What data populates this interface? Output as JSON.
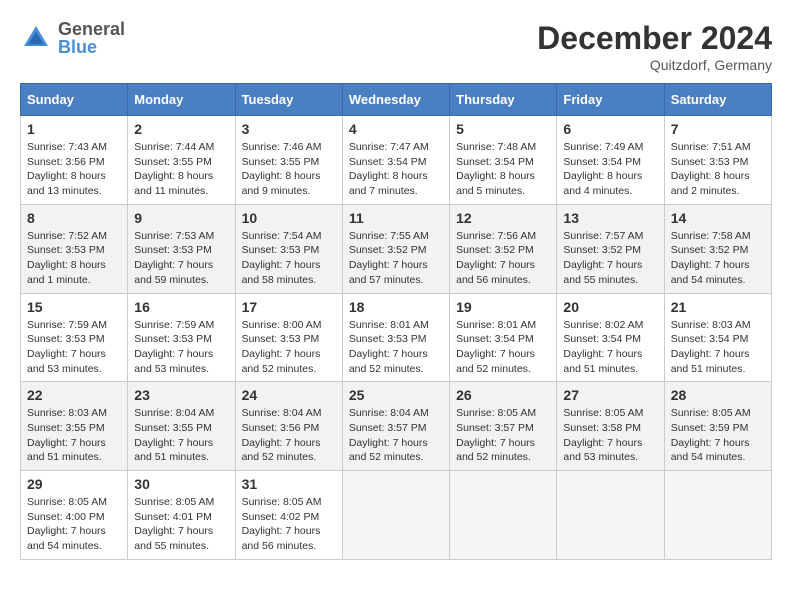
{
  "header": {
    "logo_line1": "General",
    "logo_line2": "Blue",
    "month_title": "December 2024",
    "location": "Quitzdorf, Germany"
  },
  "weekdays": [
    "Sunday",
    "Monday",
    "Tuesday",
    "Wednesday",
    "Thursday",
    "Friday",
    "Saturday"
  ],
  "weeks": [
    [
      {
        "day": 1,
        "sunrise": "7:43 AM",
        "sunset": "3:56 PM",
        "daylight": "8 hours and 13 minutes."
      },
      {
        "day": 2,
        "sunrise": "7:44 AM",
        "sunset": "3:55 PM",
        "daylight": "8 hours and 11 minutes."
      },
      {
        "day": 3,
        "sunrise": "7:46 AM",
        "sunset": "3:55 PM",
        "daylight": "8 hours and 9 minutes."
      },
      {
        "day": 4,
        "sunrise": "7:47 AM",
        "sunset": "3:54 PM",
        "daylight": "8 hours and 7 minutes."
      },
      {
        "day": 5,
        "sunrise": "7:48 AM",
        "sunset": "3:54 PM",
        "daylight": "8 hours and 5 minutes."
      },
      {
        "day": 6,
        "sunrise": "7:49 AM",
        "sunset": "3:54 PM",
        "daylight": "8 hours and 4 minutes."
      },
      {
        "day": 7,
        "sunrise": "7:51 AM",
        "sunset": "3:53 PM",
        "daylight": "8 hours and 2 minutes."
      }
    ],
    [
      {
        "day": 8,
        "sunrise": "7:52 AM",
        "sunset": "3:53 PM",
        "daylight": "8 hours and 1 minute."
      },
      {
        "day": 9,
        "sunrise": "7:53 AM",
        "sunset": "3:53 PM",
        "daylight": "7 hours and 59 minutes."
      },
      {
        "day": 10,
        "sunrise": "7:54 AM",
        "sunset": "3:53 PM",
        "daylight": "7 hours and 58 minutes."
      },
      {
        "day": 11,
        "sunrise": "7:55 AM",
        "sunset": "3:52 PM",
        "daylight": "7 hours and 57 minutes."
      },
      {
        "day": 12,
        "sunrise": "7:56 AM",
        "sunset": "3:52 PM",
        "daylight": "7 hours and 56 minutes."
      },
      {
        "day": 13,
        "sunrise": "7:57 AM",
        "sunset": "3:52 PM",
        "daylight": "7 hours and 55 minutes."
      },
      {
        "day": 14,
        "sunrise": "7:58 AM",
        "sunset": "3:52 PM",
        "daylight": "7 hours and 54 minutes."
      }
    ],
    [
      {
        "day": 15,
        "sunrise": "7:59 AM",
        "sunset": "3:53 PM",
        "daylight": "7 hours and 53 minutes."
      },
      {
        "day": 16,
        "sunrise": "7:59 AM",
        "sunset": "3:53 PM",
        "daylight": "7 hours and 53 minutes."
      },
      {
        "day": 17,
        "sunrise": "8:00 AM",
        "sunset": "3:53 PM",
        "daylight": "7 hours and 52 minutes."
      },
      {
        "day": 18,
        "sunrise": "8:01 AM",
        "sunset": "3:53 PM",
        "daylight": "7 hours and 52 minutes."
      },
      {
        "day": 19,
        "sunrise": "8:01 AM",
        "sunset": "3:54 PM",
        "daylight": "7 hours and 52 minutes."
      },
      {
        "day": 20,
        "sunrise": "8:02 AM",
        "sunset": "3:54 PM",
        "daylight": "7 hours and 51 minutes."
      },
      {
        "day": 21,
        "sunrise": "8:03 AM",
        "sunset": "3:54 PM",
        "daylight": "7 hours and 51 minutes."
      }
    ],
    [
      {
        "day": 22,
        "sunrise": "8:03 AM",
        "sunset": "3:55 PM",
        "daylight": "7 hours and 51 minutes."
      },
      {
        "day": 23,
        "sunrise": "8:04 AM",
        "sunset": "3:55 PM",
        "daylight": "7 hours and 51 minutes."
      },
      {
        "day": 24,
        "sunrise": "8:04 AM",
        "sunset": "3:56 PM",
        "daylight": "7 hours and 52 minutes."
      },
      {
        "day": 25,
        "sunrise": "8:04 AM",
        "sunset": "3:57 PM",
        "daylight": "7 hours and 52 minutes."
      },
      {
        "day": 26,
        "sunrise": "8:05 AM",
        "sunset": "3:57 PM",
        "daylight": "7 hours and 52 minutes."
      },
      {
        "day": 27,
        "sunrise": "8:05 AM",
        "sunset": "3:58 PM",
        "daylight": "7 hours and 53 minutes."
      },
      {
        "day": 28,
        "sunrise": "8:05 AM",
        "sunset": "3:59 PM",
        "daylight": "7 hours and 54 minutes."
      }
    ],
    [
      {
        "day": 29,
        "sunrise": "8:05 AM",
        "sunset": "4:00 PM",
        "daylight": "7 hours and 54 minutes."
      },
      {
        "day": 30,
        "sunrise": "8:05 AM",
        "sunset": "4:01 PM",
        "daylight": "7 hours and 55 minutes."
      },
      {
        "day": 31,
        "sunrise": "8:05 AM",
        "sunset": "4:02 PM",
        "daylight": "7 hours and 56 minutes."
      },
      null,
      null,
      null,
      null
    ]
  ]
}
